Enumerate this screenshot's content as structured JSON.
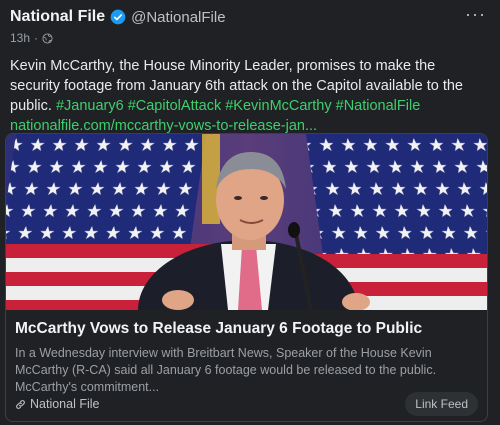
{
  "author": {
    "name": "National File",
    "handle": "@NationalFile"
  },
  "meta": {
    "time": "13h",
    "separator": "·"
  },
  "post": {
    "text": "Kevin McCarthy, the House Minority Leader, promises to make the security footage from January 6th attack on the Capitol available to the public.",
    "hashtags": [
      "#January6",
      "#CapitolAttack",
      "#KevinMcCarthy",
      "#NationalFile"
    ],
    "link": "nationalfile.com/mccarthy-vows-to-release-jan..."
  },
  "card": {
    "title": "McCarthy Vows to Release January 6 Footage to Public",
    "description": "In a Wednesday interview with Breitbart News, Speaker of the House Kevin McCarthy (R-CA) said all January 6 footage would be released to the public. McCarthy's commitment...",
    "source": "National File",
    "feed_button": "Link Feed"
  },
  "colors": {
    "accent": "#3ecf6d",
    "verified": "#1d9bf0",
    "background": "#202124"
  },
  "icons": {
    "more": "more-horizontal-icon",
    "globe": "globe-icon",
    "verified": "verified-badge-icon",
    "link": "link-icon"
  }
}
